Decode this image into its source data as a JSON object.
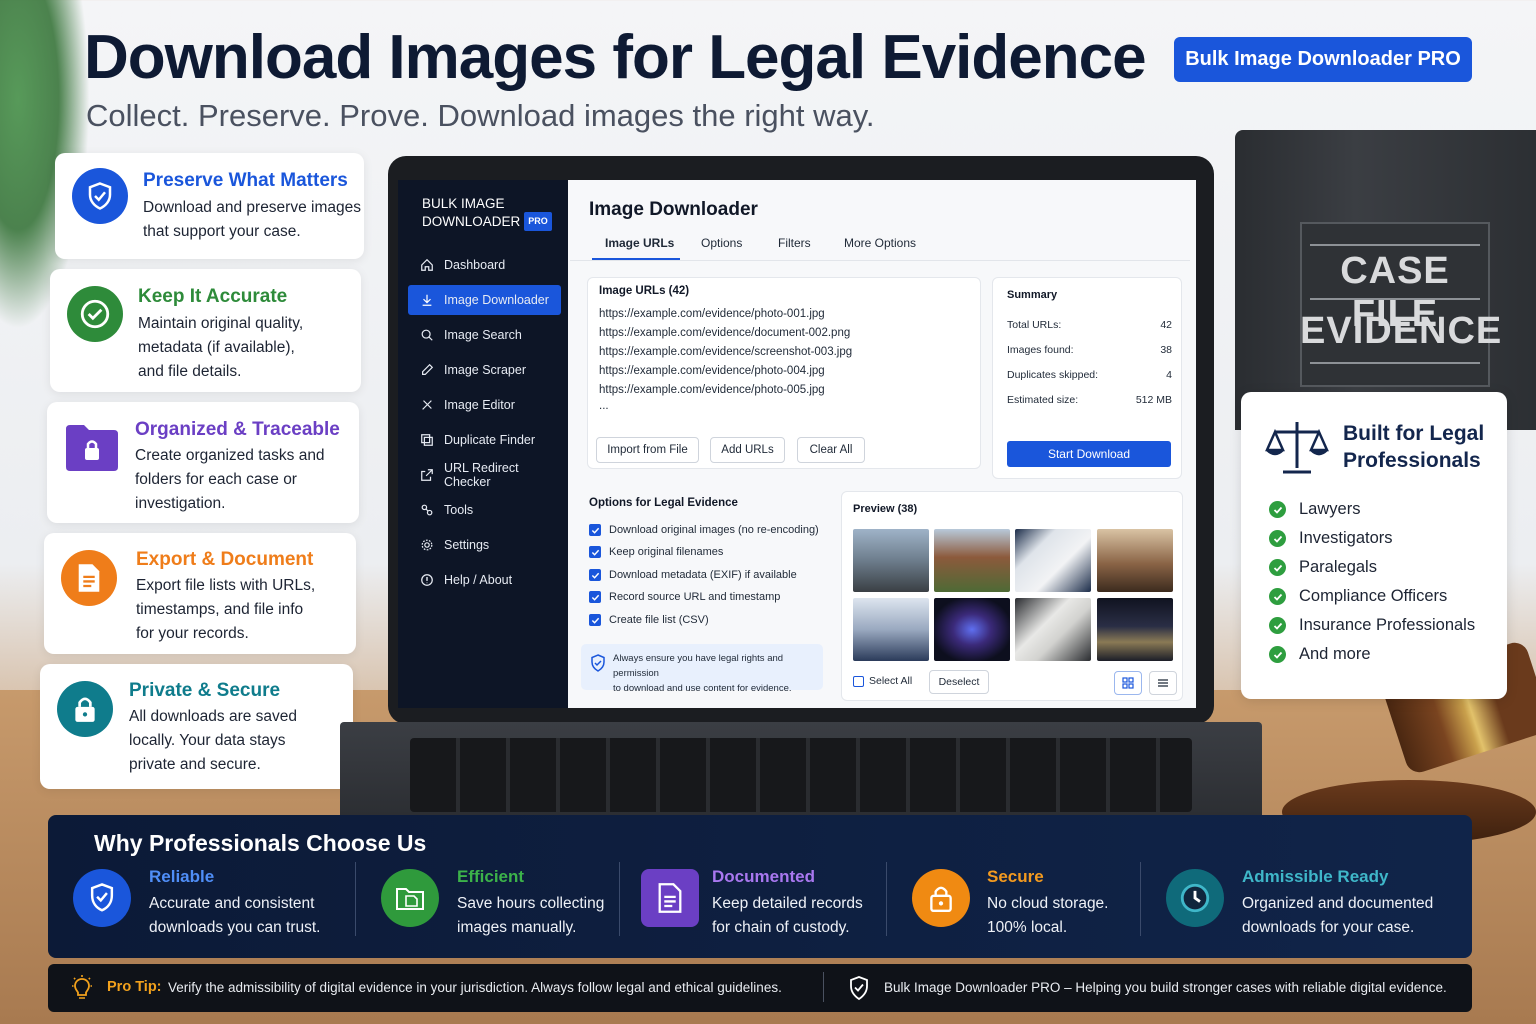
{
  "header": {
    "title": "Download Images for Legal Evidence",
    "subtitle": "Collect. Preserve. Prove. Download images the right way.",
    "badge": "Bulk Image Downloader PRO"
  },
  "binder": {
    "line1": "CASE FILE",
    "line2": "EVIDENCE"
  },
  "features": [
    {
      "title": "Preserve What Matters",
      "desc1": "Download and preserve images",
      "desc2": "that support your case.",
      "desc3": "",
      "color": "#1a56db",
      "icon": "shield-check-icon"
    },
    {
      "title": "Keep It Accurate",
      "desc1": "Maintain original quality,",
      "desc2": "metadata (if available),",
      "desc3": "and file details.",
      "color": "#2e8b3a",
      "icon": "check-circle-icon"
    },
    {
      "title": "Organized & Traceable",
      "desc1": "Create organized tasks and",
      "desc2": "folders for each case or",
      "desc3": "investigation.",
      "color": "#6b3fc4",
      "icon": "folder-lock-icon"
    },
    {
      "title": "Export & Document",
      "desc1": "Export file lists with URLs,",
      "desc2": "timestamps, and file info",
      "desc3": "for your records.",
      "color": "#ef7d1a",
      "icon": "document-icon"
    },
    {
      "title": "Private & Secure",
      "desc1": "All downloads are saved",
      "desc2": "locally. Your data stays",
      "desc3": "private and secure.",
      "color": "#0f7c8c",
      "icon": "lock-icon"
    }
  ],
  "app": {
    "brand_line1": "BULK IMAGE",
    "brand_line2": "DOWNLOADER",
    "pro_tag": "PRO",
    "nav": [
      {
        "label": "Dashboard",
        "icon": "home-icon"
      },
      {
        "label": "Image Downloader",
        "icon": "download-icon"
      },
      {
        "label": "Image Search",
        "icon": "search-icon"
      },
      {
        "label": "Image Scraper",
        "icon": "edit-icon"
      },
      {
        "label": "Image Editor",
        "icon": "tools-icon"
      },
      {
        "label": "Duplicate Finder",
        "icon": "copy-icon"
      },
      {
        "label": "URL Redirect Checker",
        "icon": "external-link-icon"
      },
      {
        "label": "Tools",
        "icon": "wrench-icon"
      },
      {
        "label": "Settings",
        "icon": "gear-icon"
      },
      {
        "label": "Help / About",
        "icon": "help-icon"
      }
    ],
    "title": "Image Downloader",
    "tabs": [
      "Image URLs",
      "Options",
      "Filters",
      "More Options"
    ],
    "urls_header": "Image URLs (42)",
    "urls": [
      "https://example.com/evidence/photo-001.jpg",
      "https://example.com/evidence/document-002.png",
      "https://example.com/evidence/screenshot-003.jpg",
      "https://example.com/evidence/photo-004.jpg",
      "https://example.com/evidence/photo-005.jpg",
      "..."
    ],
    "url_buttons": [
      "Import from File",
      "Add URLs",
      "Clear All"
    ],
    "summary": {
      "title": "Summary",
      "rows": [
        {
          "label": "Total URLs:",
          "value": "42"
        },
        {
          "label": "Images found:",
          "value": "38"
        },
        {
          "label": "Duplicates skipped:",
          "value": "4"
        },
        {
          "label": "Estimated size:",
          "value": "512 MB"
        }
      ],
      "start_label": "Start Download"
    },
    "options": {
      "title": "Options for Legal Evidence",
      "items": [
        "Download original images (no re-encoding)",
        "Keep original filenames",
        "Download metadata (EXIF) if available",
        "Record source URL and timestamp",
        "Create file list (CSV)"
      ],
      "note_line1": "Always ensure you have legal rights and permission",
      "note_line2": "to download and use content for evidence."
    },
    "preview": {
      "title": "Preview (38)",
      "select_all": "Select All",
      "deselect": "Deselect"
    }
  },
  "legal": {
    "title_line1": "Built for Legal",
    "title_line2": "Professionals",
    "items": [
      "Lawyers",
      "Investigators",
      "Paralegals",
      "Compliance Officers",
      "Insurance Professionals",
      "And more"
    ]
  },
  "why": {
    "title": "Why Professionals Choose Us",
    "items": [
      {
        "title": "Reliable",
        "desc1": "Accurate and consistent",
        "desc2": "downloads you can trust.",
        "color": "#4f8ef7",
        "icon": "shield-check-icon"
      },
      {
        "title": "Efficient",
        "desc1": "Save hours collecting",
        "desc2": "images manually.",
        "color": "#3cb34a",
        "icon": "folder-icon"
      },
      {
        "title": "Documented",
        "desc1": "Keep detailed records",
        "desc2": "for chain of custody.",
        "color": "#a978f0",
        "icon": "document-icon"
      },
      {
        "title": "Secure",
        "desc1": "No cloud storage.",
        "desc2": "100% local.",
        "color": "#f39a1f",
        "icon": "lock-icon"
      },
      {
        "title": "Admissible Ready",
        "desc1": "Organized and documented",
        "desc2": "downloads for your case.",
        "color": "#3fb7c9",
        "icon": "clock-icon"
      }
    ]
  },
  "tip": {
    "label": "Pro Tip:",
    "text": "Verify the admissibility of digital evidence in your jurisdiction. Always follow legal and ethical guidelines.",
    "tagline": "Bulk Image Downloader PRO – Helping you build stronger cases with reliable digital evidence."
  }
}
